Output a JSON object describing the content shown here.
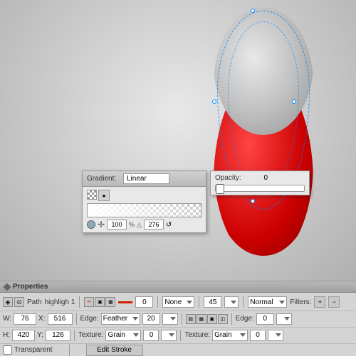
{
  "canvas": {
    "background": "gradient gray"
  },
  "gradient_panel": {
    "title": "Gradient:",
    "type": "Linear",
    "move_value": "100",
    "unit": "%",
    "angle_value": "276"
  },
  "opacity_panel": {
    "label": "Opacity:",
    "value": "0"
  },
  "properties_panel": {
    "title": "Properties"
  },
  "toolbar": {
    "path_label": "Path",
    "highlight_label": "highligh 1",
    "edge_label": "Edge:",
    "edge_type": "Feather",
    "edge_value": "20",
    "edge_unit": "%",
    "edge2_label": "Edge:",
    "edge2_value": "0",
    "none_label": "None",
    "filter_value": "45",
    "normal_label": "Normal",
    "w_label": "W:",
    "w_value": "76",
    "x_label": "X:",
    "x_value": "516",
    "texture_label": "Texture:",
    "texture_type": "Grain",
    "texture_value": "0",
    "texture_unit": "%",
    "texture2_label": "Texture:",
    "texture2_type": "Grain",
    "texture2_value": "0%",
    "h_label": "H:",
    "h_value": "420",
    "y_label": "Y:",
    "y_value": "126",
    "transparent_label": "Transparent",
    "edit_stroke_label": "Edit Stroke"
  }
}
